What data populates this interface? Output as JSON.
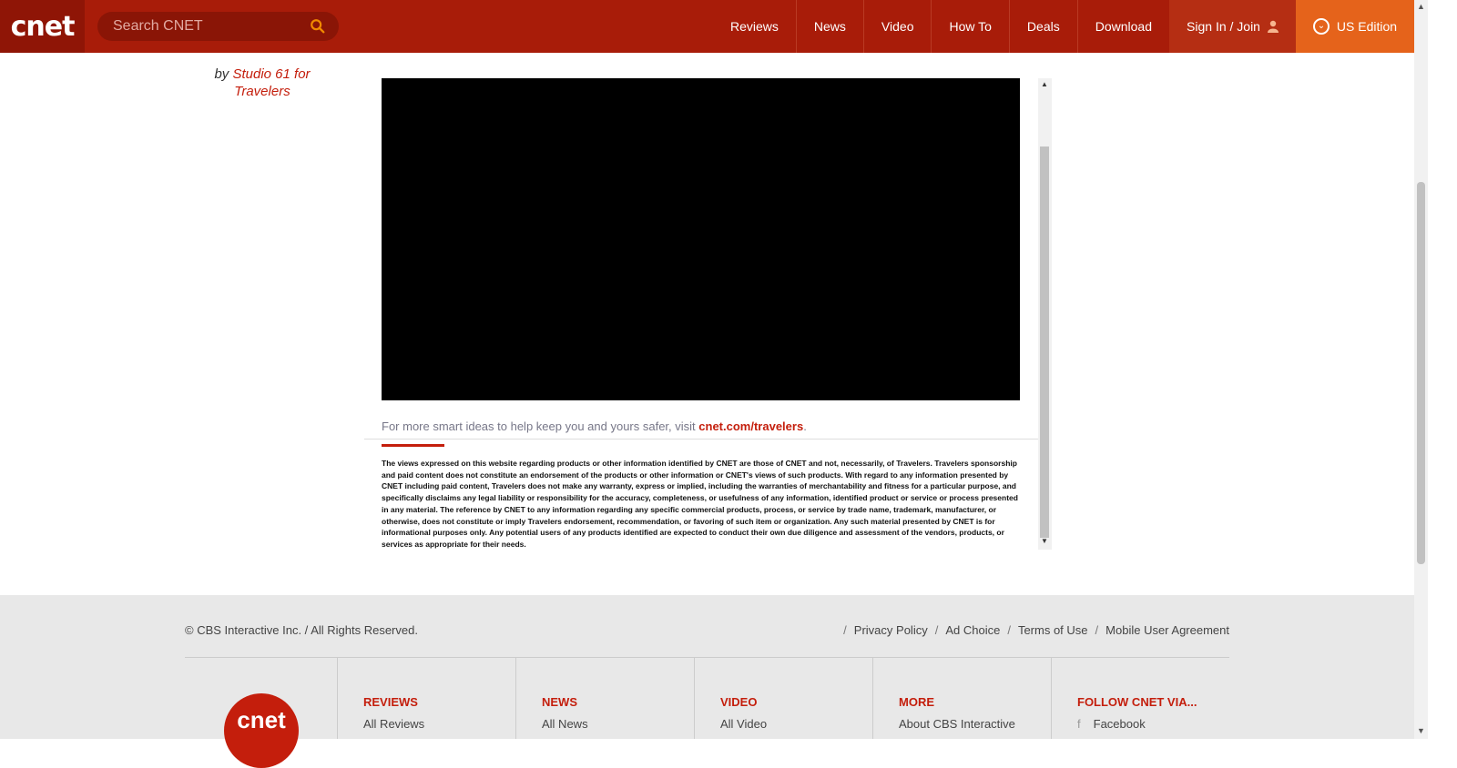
{
  "header": {
    "logo_text": "cnet",
    "search_placeholder": "Search CNET",
    "nav": [
      "Reviews",
      "News",
      "Video",
      "How To",
      "Deals",
      "Download"
    ],
    "signin_label": "Sign In / Join",
    "edition_label": "US Edition"
  },
  "byline": {
    "prefix": "by",
    "link": "Studio 61 for Travelers"
  },
  "content": {
    "cta_text": "For more smart ideas to help keep you and yours safer, visit ",
    "cta_link": "cnet.com/travelers",
    "cta_suffix": ".",
    "disclaimer": "The views expressed on this website regarding products or other information identified by CNET are those of CNET and not, necessarily, of Travelers. Travelers sponsorship and paid content does not constitute an endorsement of the products or other information or CNET's views of such products. With regard to any information presented by CNET including paid content, Travelers does not make any warranty, express or implied, including the warranties of merchantability and fitness for a particular purpose, and specifically disclaims any legal liability or responsibility for the accuracy, completeness, or usefulness of any information, identified product or service or process presented in any material. The reference by CNET to any information regarding any specific commercial products, process, or service by trade name, trademark, manufacturer, or otherwise, does not constitute or imply Travelers endorsement, recommendation, or favoring of such item or organization. Any such material presented by CNET is for informational purposes only. Any potential users of any products identified are expected to conduct their own due diligence and assessment of the vendors, products, or services as appropriate for their needs."
  },
  "footer": {
    "copyright": "© CBS Interactive Inc.  /  All Rights Reserved.",
    "legal_links": [
      "Privacy Policy",
      "Ad Choice",
      "Terms of Use",
      "Mobile User Agreement"
    ],
    "logo_text": "cnet",
    "columns": [
      {
        "heading": "REVIEWS",
        "link": "All Reviews"
      },
      {
        "heading": "NEWS",
        "link": "All News"
      },
      {
        "heading": "VIDEO",
        "link": "All Video"
      },
      {
        "heading": "MORE",
        "link": "About CBS Interactive"
      },
      {
        "heading": "FOLLOW CNET VIA...",
        "link": "Facebook"
      }
    ]
  },
  "colors": {
    "header": "#a81c09",
    "accent": "#c41e0c",
    "edition": "#e5631b"
  }
}
